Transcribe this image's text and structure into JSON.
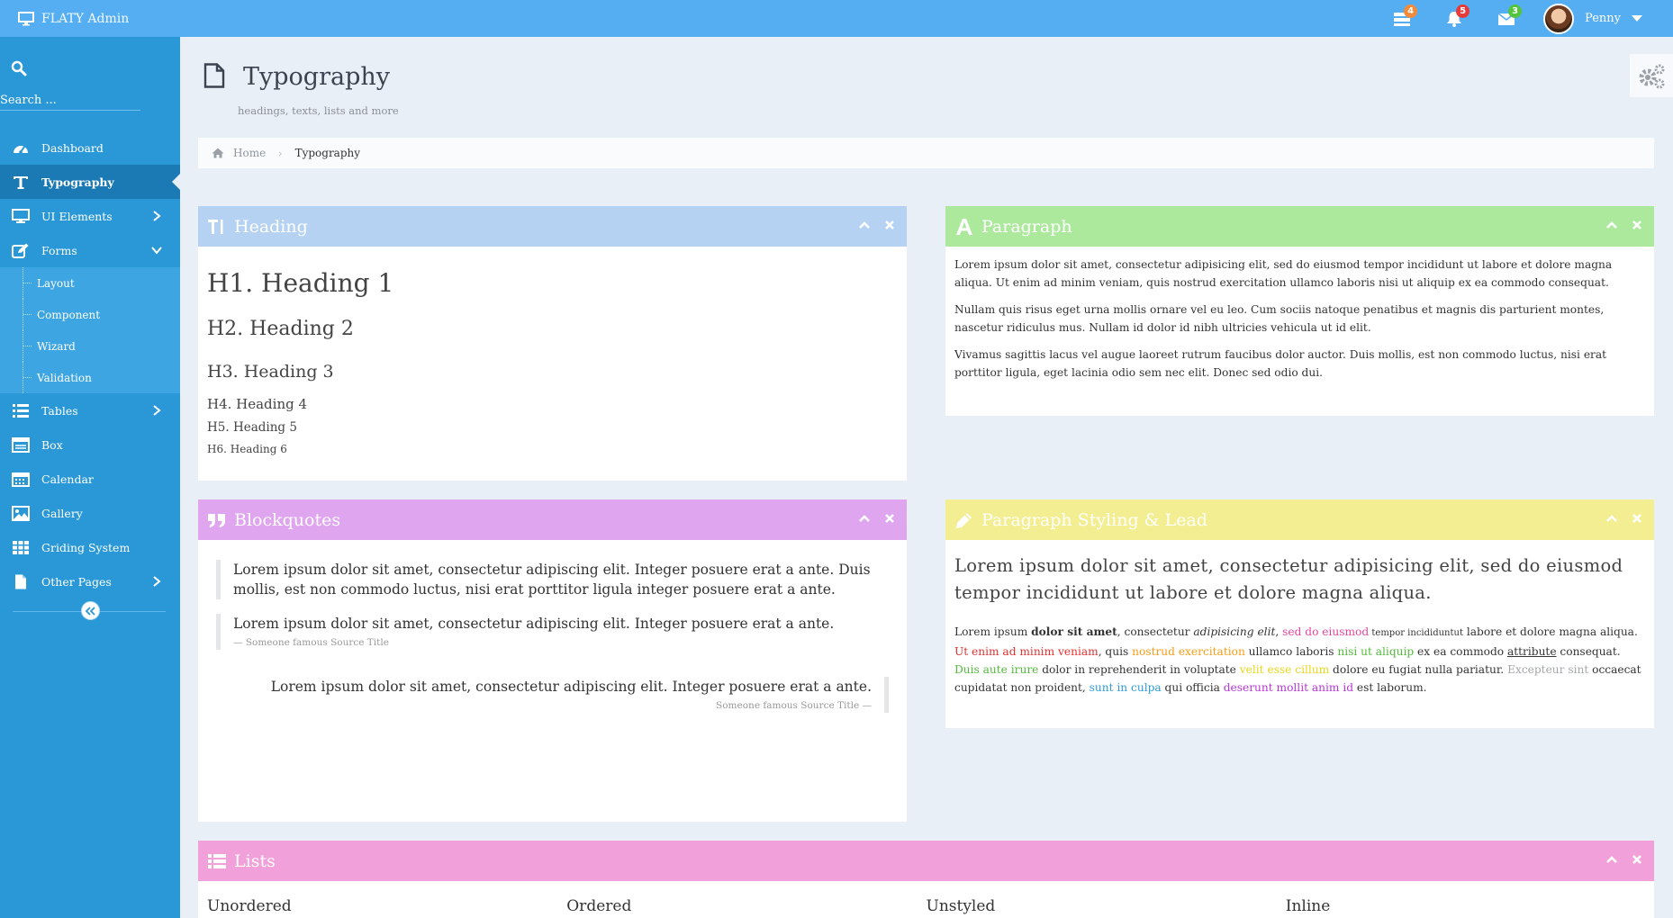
{
  "app": {
    "title": "FLATY Admin"
  },
  "navbar": {
    "tasks_count": "4",
    "notifications_count": "5",
    "messages_count": "3",
    "user_name": "Penny",
    "colors": {
      "tasks_badge": "#f58b3a",
      "notifications_badge": "#e73a3a",
      "messages_badge": "#54c43c"
    }
  },
  "sidebar": {
    "search_placeholder": "Search ...",
    "items": [
      {
        "label": "Dashboard"
      },
      {
        "label": "Typography"
      },
      {
        "label": "UI Elements"
      },
      {
        "label": "Forms"
      },
      {
        "label": "Tables"
      },
      {
        "label": "Box"
      },
      {
        "label": "Calendar"
      },
      {
        "label": "Gallery"
      },
      {
        "label": "Griding System"
      },
      {
        "label": "Other Pages"
      }
    ],
    "forms_sub": [
      {
        "label": "Layout"
      },
      {
        "label": "Component"
      },
      {
        "label": "Wizard"
      },
      {
        "label": "Validation"
      }
    ]
  },
  "page": {
    "title": "Typography",
    "subtitle": "headings, texts, lists and more"
  },
  "breadcrumb": {
    "home": "Home",
    "current": "Typography"
  },
  "boxes": {
    "heading": {
      "title": "Heading",
      "h1": "H1. Heading 1",
      "h2": "H2. Heading 2",
      "h3": "H3. Heading 3",
      "h4": "H4. Heading 4",
      "h5": "H5. Heading 5",
      "h6": "H6. Heading 6"
    },
    "paragraph": {
      "title": "Paragraph",
      "p1": "Lorem ipsum dolor sit amet, consectetur adipisicing elit, sed do eiusmod tempor incididunt ut labore et dolore magna aliqua. Ut enim ad minim veniam, quis nostrud exercitation ullamco laboris nisi ut aliquip ex ea commodo consequat.",
      "p2": "Nullam quis risus eget urna mollis ornare vel eu leo. Cum sociis natoque penatibus et magnis dis parturient montes, nascetur ridiculus mus. Nullam id dolor id nibh ultricies vehicula ut id elit.",
      "p3": "Vivamus sagittis lacus vel augue laoreet rutrum faucibus dolor auctor. Duis mollis, est non commodo luctus, nisi erat porttitor ligula, eget lacinia odio sem nec elit. Donec sed odio dui."
    },
    "blockquotes": {
      "title": "Blockquotes",
      "q1": "Lorem ipsum dolor sit amet, consectetur adipiscing elit. Integer posuere erat a ante. Duis mollis, est non commodo luctus, nisi erat porttitor ligula integer posuere erat a ante.",
      "q2": "Lorem ipsum dolor sit amet, consectetur adipiscing elit. Integer posuere erat a ante.",
      "q2_source": "— Someone famous Source Title",
      "q3": "Lorem ipsum dolor sit amet, consectetur adipiscing elit. Integer posuere erat a ante.",
      "q3_source": "Someone famous Source Title —"
    },
    "styling": {
      "title": "Paragraph Styling & Lead",
      "lead": "Lorem ipsum dolor sit amet, consectetur adipisicing elit, sed do eiusmod tempor incididunt ut labore et dolore magna aliqua.",
      "s_lorem": "Lorem ipsum ",
      "s_bold": "dolor sit amet",
      "s_consectetur": ", consectetur ",
      "s_italic": "adipisicing elit",
      "s_comma": ", ",
      "s_pink": "sed do eiusmod",
      "s_small": " tempor incididuntut",
      "s_labore": " labore et dolore magna aliqua. ",
      "s_red": "Ut enim ad minim veniam",
      "s_quis": ", quis ",
      "s_orange": "nostrud exercitation",
      "s_ullamco": " ullamco laboris ",
      "s_green1": "nisi ut aliquip",
      "s_exea": " ex ea commodo ",
      "s_underline": "attribute",
      "s_consequat": " consequat. ",
      "s_green2": "Duis aute irure",
      "s_dolor": " dolor in reprehenderit in voluptate ",
      "s_yellow": "velit esse cillum",
      "s_dolore": " dolore eu fugiat nulla pariatur. ",
      "s_gray": "Excepteur sint",
      "s_occaecat": " occaecat cupidatat non proident, ",
      "s_blue": "sunt in culpa",
      "s_qui": " qui officia ",
      "s_purple": "deserunt mollit anim id",
      "s_end": " est laborum."
    },
    "lists": {
      "title": "Lists",
      "cols": [
        "Unordered",
        "Ordered",
        "Unstyled",
        "Inline"
      ]
    }
  },
  "colors": {
    "navbar": "#55aef1",
    "sidebar": "#2a98d7",
    "sidebar_active": "#1b79b3",
    "heading_box": "#b5d2f3",
    "paragraph_box": "#ade99d",
    "blockquotes_box": "#dfa5ef",
    "styling_box": "#f3ee91",
    "lists_box": "#f2a0da"
  },
  "icons": [
    "desktop-icon",
    "tasks-icon",
    "bell-icon",
    "envelope-icon",
    "search-icon",
    "dashboard-icon",
    "text-icon",
    "monitor-icon",
    "edit-icon",
    "table-icon",
    "box-icon",
    "calendar-icon",
    "picture-icon",
    "grid-icon",
    "file-icon",
    "gears-icon",
    "home-icon",
    "chevron-up-icon",
    "close-icon",
    "font-icon",
    "quote-icon",
    "pencil-icon",
    "list-icon"
  ]
}
